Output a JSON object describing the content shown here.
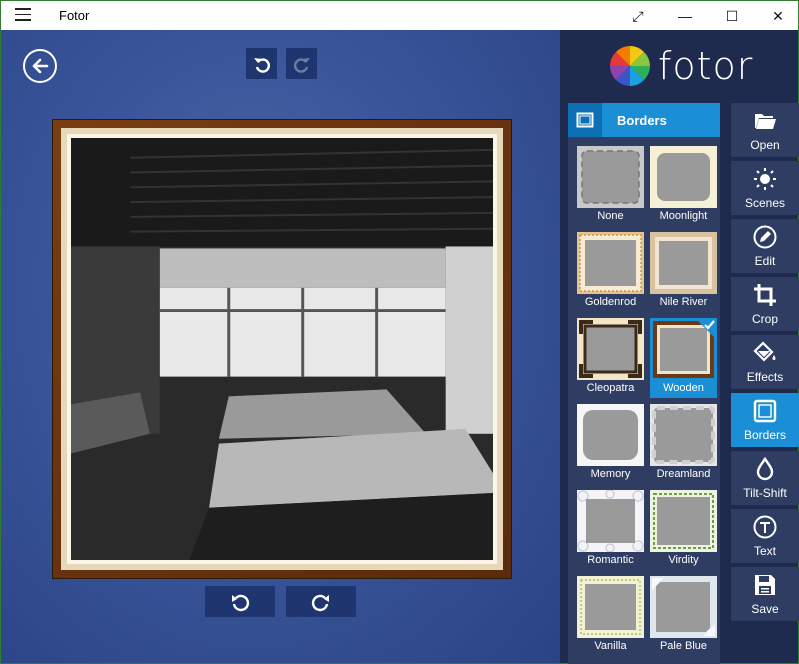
{
  "window": {
    "title": "Fotor",
    "expand_glyph": "⤢",
    "minimize_glyph": "—",
    "maximize_glyph": "☐",
    "close_glyph": "✕"
  },
  "app": {
    "logo_text": "fotor"
  },
  "borders_panel": {
    "header": "Borders",
    "items": [
      {
        "label": "None",
        "selected": false
      },
      {
        "label": "Moonlight",
        "selected": false
      },
      {
        "label": "Goldenrod",
        "selected": false
      },
      {
        "label": "Nile River",
        "selected": false
      },
      {
        "label": "Cleopatra",
        "selected": false
      },
      {
        "label": "Wooden",
        "selected": true
      },
      {
        "label": "Memory",
        "selected": false
      },
      {
        "label": "Dreamland",
        "selected": false
      },
      {
        "label": "Romantic",
        "selected": false
      },
      {
        "label": "Virdity",
        "selected": false
      },
      {
        "label": "Vanilla",
        "selected": false
      },
      {
        "label": "Pale Blue",
        "selected": false
      }
    ]
  },
  "tools": [
    {
      "label": "Open",
      "icon": "folder-icon",
      "active": false
    },
    {
      "label": "Scenes",
      "icon": "sun-icon",
      "active": false
    },
    {
      "label": "Edit",
      "icon": "pencil-icon",
      "active": false
    },
    {
      "label": "Crop",
      "icon": "crop-icon",
      "active": false
    },
    {
      "label": "Effects",
      "icon": "paint-bucket-icon",
      "active": false
    },
    {
      "label": "Borders",
      "icon": "borders-icon",
      "active": true
    },
    {
      "label": "Tilt-Shift",
      "icon": "drop-icon",
      "active": false
    },
    {
      "label": "Text",
      "icon": "text-icon",
      "active": false
    },
    {
      "label": "Save",
      "icon": "floppy-icon",
      "active": false
    }
  ],
  "colors": {
    "accent": "#1a8fd6",
    "panel": "#1e2b4f",
    "canvas": "#3a559a"
  }
}
